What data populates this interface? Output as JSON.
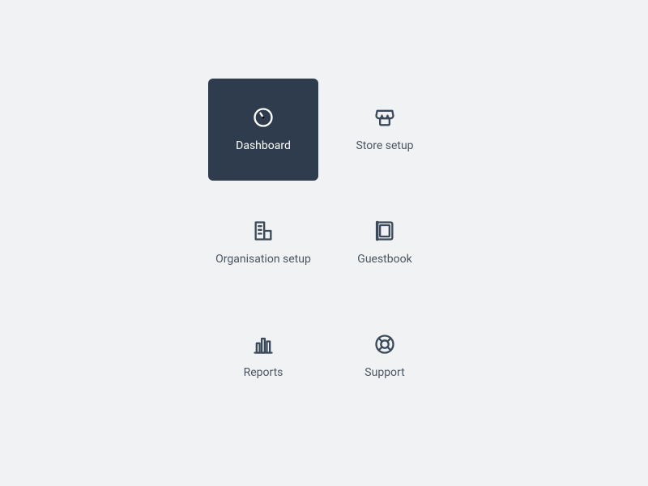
{
  "menu": {
    "items": [
      {
        "label": "Dashboard",
        "icon": "gauge-icon",
        "active": true
      },
      {
        "label": "Store setup",
        "icon": "store-icon",
        "active": false
      },
      {
        "label": "Organisation setup",
        "icon": "building-icon",
        "active": false
      },
      {
        "label": "Guestbook",
        "icon": "book-icon",
        "active": false
      },
      {
        "label": "Reports",
        "icon": "bar-chart-icon",
        "active": false
      },
      {
        "label": "Support",
        "icon": "lifebuoy-icon",
        "active": false
      }
    ]
  },
  "colors": {
    "tile_active_bg": "#2e3c4e",
    "page_bg": "#f1f2f3",
    "icon_stroke": "#3b4a5a",
    "label_color": "#4a5560",
    "active_fg": "#ffffff"
  }
}
